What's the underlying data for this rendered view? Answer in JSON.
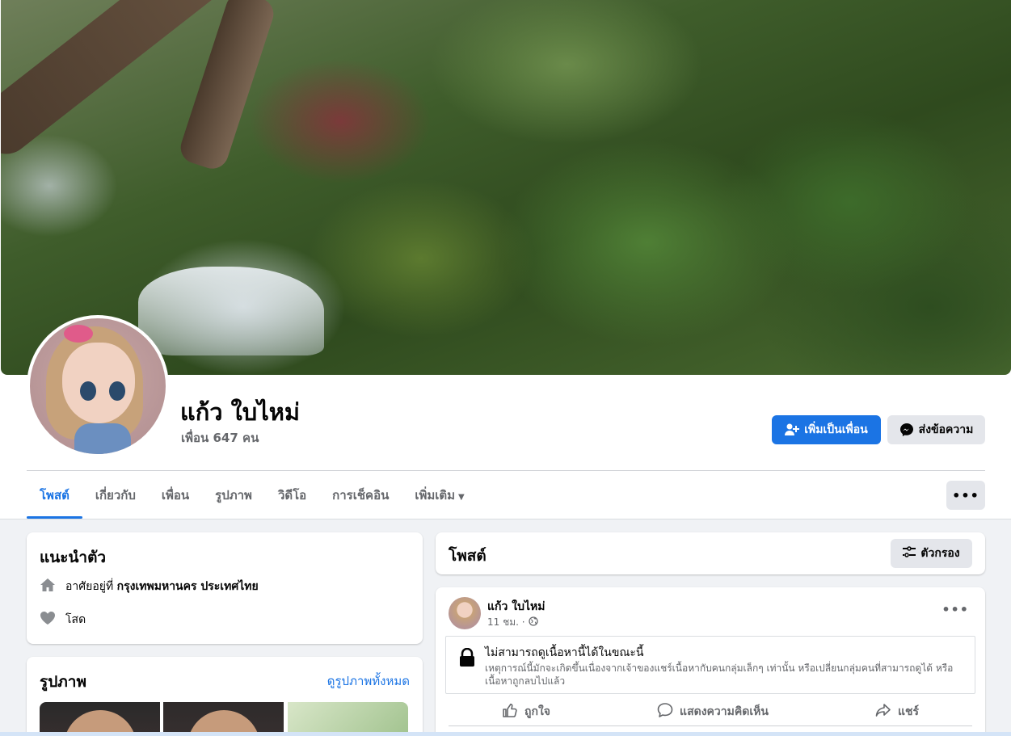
{
  "profile": {
    "name": "แก้ว ใบไหม่",
    "friends_count": "เพื่อน 647 คน"
  },
  "actions": {
    "add_friend": "เพิ่มเป็นเพื่อน",
    "message": "ส่งข้อความ"
  },
  "tabs": [
    {
      "label": "โพสต์",
      "active": true
    },
    {
      "label": "เกี่ยวกับ",
      "active": false
    },
    {
      "label": "เพื่อน",
      "active": false
    },
    {
      "label": "รูปภาพ",
      "active": false
    },
    {
      "label": "วิดีโอ",
      "active": false
    },
    {
      "label": "การเช็คอิน",
      "active": false
    },
    {
      "label": "เพิ่มเติม",
      "active": false
    }
  ],
  "more_button": "•••",
  "intro": {
    "title": "แนะนำตัว",
    "lives_prefix": "อาศัยอยู่ที่",
    "lives_place": "กรุงเทพมหานคร ประเทศไทย",
    "relationship": "โสด"
  },
  "photos": {
    "title": "รูปภาพ",
    "see_all": "ดูรูปภาพทั้งหมด"
  },
  "posts": {
    "title": "โพสต์",
    "filter": "ตัวกรอง"
  },
  "post": {
    "author": "แก้ว ใบไหม่",
    "time": "11 ชม. ·",
    "more": "•••",
    "notice_title": "ไม่สามารถดูเนื้อหานี้ได้ในขณะนี้",
    "notice_desc": "เหตุการณ์นี้มักจะเกิดขึ้นเนื่องจากเจ้าของแชร์เนื้อหากับคนกลุ่มเล็กๆ เท่านั้น หรือเปลี่ยนกลุ่มคนที่สามารถดูได้ หรือเนื้อหาถูกลบไปแล้ว",
    "like": "ถูกใจ",
    "comment": "แสดงความคิดเห็น",
    "share": "แชร์"
  },
  "colors": {
    "accent": "#1b74e4",
    "background": "#f0f2f5",
    "secondary_text": "#65676b"
  }
}
